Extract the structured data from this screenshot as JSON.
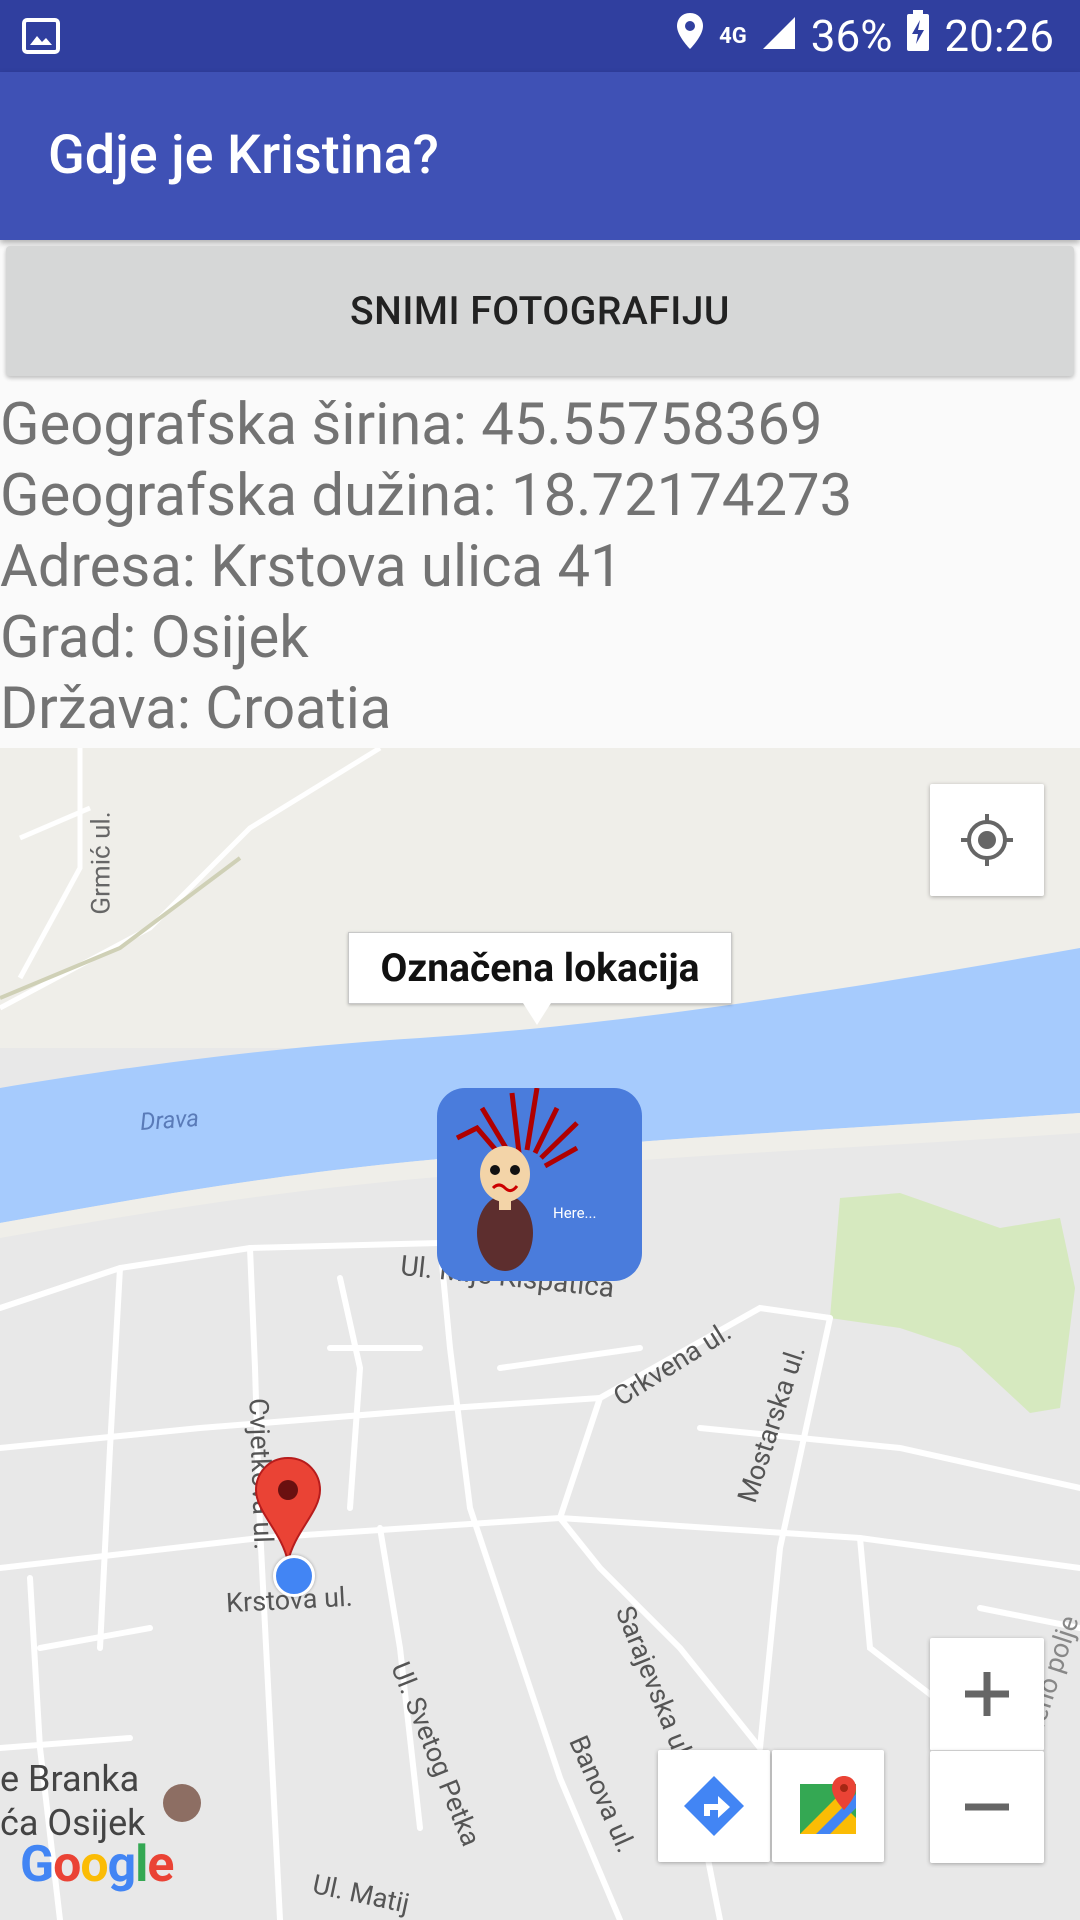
{
  "status_bar": {
    "gallery_icon": "image-icon",
    "network": "4G",
    "battery": "36%",
    "time": "20:26"
  },
  "app_bar": {
    "title": "Gdje je Kristina?"
  },
  "capture_button": {
    "label": "SNIMI FOTOGRAFIJU"
  },
  "location_info": {
    "latitude": "Geografska širina: 45.55758369",
    "longitude": "Geografska dužina: 18.72174273",
    "address": "Adresa: Krstova ulica 41",
    "city": "Grad: Osijek",
    "country": "Država: Croatia"
  },
  "map": {
    "info_window": "Označena lokacija",
    "marker_caption": "Here...",
    "labels": {
      "grmic": "Grmić ul.",
      "drava": "Drava",
      "mije": "Ul. Mije Kišpatića",
      "crkvena": "Crkvena ul.",
      "mostarska": "Mostarska ul.",
      "cvjetkova": "Cvjetkova ul.",
      "krstova": "Krstova ul.",
      "svetog_petka": "Ul. Svetog Petka",
      "sarajevska": "Sarajevska ul.",
      "banova": "Banova ul.",
      "zeleno_polje": "Ul. Zeleno polje",
      "matije": "Ul. Matij",
      "poi_line1": "e Branka",
      "poi_line2": "ća Osijek"
    },
    "logo": [
      "G",
      "o",
      "o",
      "g",
      "l",
      "e"
    ],
    "colors": {
      "water": "#a6cbfd",
      "park": "#d6e9bf",
      "road": "#ffffff",
      "land": "#e8e8e8",
      "pin": "#ea4335",
      "my_location": "#4285f4"
    }
  }
}
